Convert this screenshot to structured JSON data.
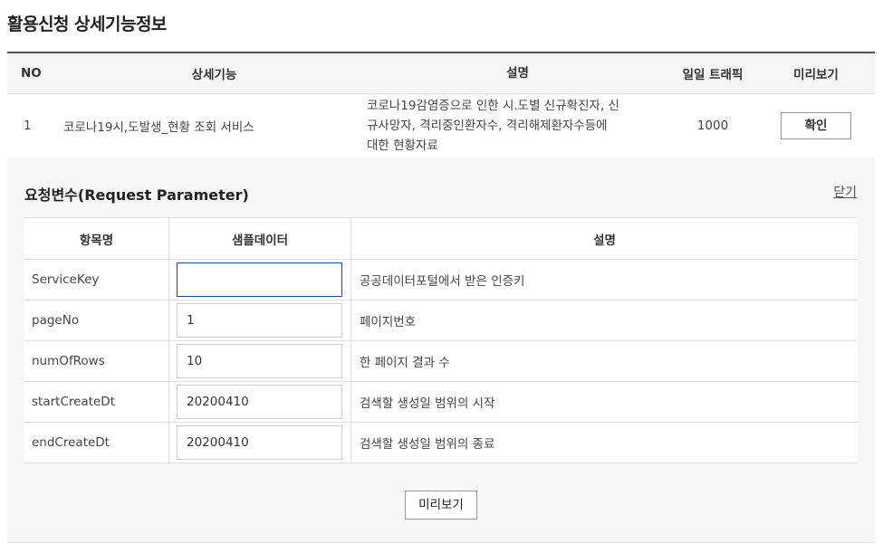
{
  "page": {
    "title": "활용신청 상세기능정보"
  },
  "func_table": {
    "headers": {
      "no": "NO",
      "feature": "상세기능",
      "desc": "설명",
      "traffic": "일일 트래픽",
      "preview": "미리보기"
    },
    "row": {
      "no": "1",
      "feature": "코로나19시,도발생_현황 조회 서비스",
      "desc_lines": [
        "코로나19감염증으로 인한 시.도별 신규확진자, 신",
        "규사망자, 격리중인환자수, 격리해제환자수등에",
        "대한 현황자료"
      ],
      "traffic": "1000",
      "confirm_label": "확인"
    }
  },
  "param_panel": {
    "title": "요청변수(Request Parameter)",
    "close_label": "닫기",
    "headers": {
      "name": "항목명",
      "sample": "샘플데이터",
      "desc": "설명"
    },
    "rows": [
      {
        "name": "ServiceKey",
        "value": "",
        "desc": "공공데이터포털에서 받은 인증키"
      },
      {
        "name": "pageNo",
        "value": "1",
        "desc": "페이지번호"
      },
      {
        "name": "numOfRows",
        "value": "10",
        "desc": "한 페이지 결과 수"
      },
      {
        "name": "startCreateDt",
        "value": "20200410",
        "desc": "검색할 생성일 범위의 시작"
      },
      {
        "name": "endCreateDt",
        "value": "20200410",
        "desc": "검색할 생성일 범위의 종료"
      }
    ],
    "preview_label": "미리보기"
  }
}
